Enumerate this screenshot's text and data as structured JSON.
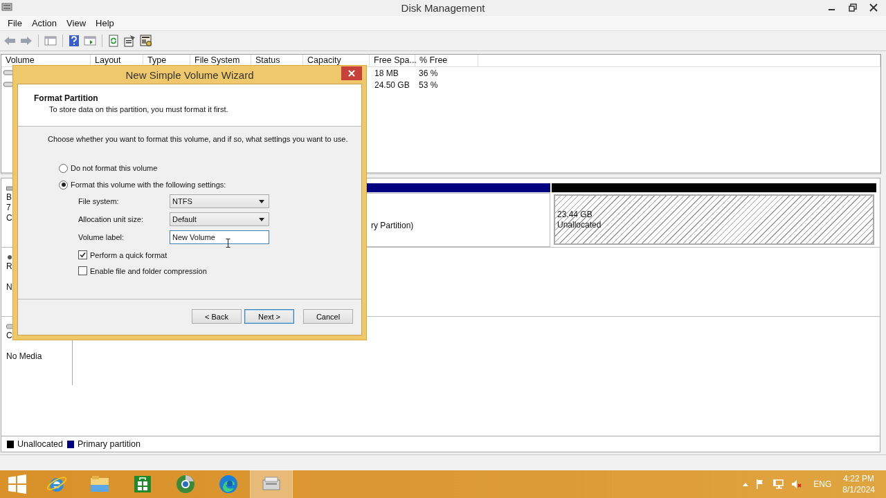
{
  "window": {
    "title": "Disk Management"
  },
  "menu": [
    "File",
    "Action",
    "View",
    "Help"
  ],
  "volume_list": {
    "columns": [
      "Volume",
      "Layout",
      "Type",
      "File System",
      "Status",
      "Capacity",
      "Free Spa...",
      "% Free"
    ],
    "rows": [
      {
        "free_space": "18 MB",
        "pct_free": "36 %"
      },
      {
        "free_space": "24.50 GB",
        "pct_free": "53 %"
      }
    ]
  },
  "disks": [
    {
      "kind": "disk",
      "label_lines": [
        "B",
        "7",
        "C"
      ],
      "partitions": [
        {
          "kind": "primary",
          "lines": [
            "ry Partition)"
          ]
        },
        {
          "kind": "unallocated",
          "lines": [
            "23.44 GB",
            "Unallocated"
          ]
        }
      ]
    },
    {
      "kind": "removable",
      "label_lines": [
        "R",
        "N"
      ]
    },
    {
      "kind": "cdrom",
      "label_lines": [
        "C",
        "No Media"
      ]
    }
  ],
  "legend": [
    {
      "label": "Unallocated",
      "color": "#000000"
    },
    {
      "label": "Primary partition",
      "color": "#000080"
    }
  ],
  "dialog": {
    "title": "New Simple Volume Wizard",
    "heading": "Format Partition",
    "subheading": "To store data on this partition, you must format it first.",
    "instruction": "Choose whether you want to format this volume, and if so, what settings you want to use.",
    "options": [
      {
        "label": "Do not format this volume",
        "selected": false
      },
      {
        "label": "Format this volume with the following settings:",
        "selected": true
      }
    ],
    "fields": [
      {
        "label": "File system:",
        "kind": "dropdown",
        "value": "NTFS"
      },
      {
        "label": "Allocation unit size:",
        "kind": "dropdown",
        "value": "Default"
      },
      {
        "label": "Volume label:",
        "kind": "text",
        "value": "New Volume"
      }
    ],
    "checkboxes": [
      {
        "label": "Perform a quick format",
        "checked": true
      },
      {
        "label": "Enable file and folder compression",
        "checked": false
      }
    ],
    "buttons": [
      {
        "label": "< Back",
        "default": false
      },
      {
        "label": "Next >",
        "default": true
      },
      {
        "label": "Cancel",
        "default": false
      }
    ]
  },
  "taskbar": {
    "apps": [
      {
        "kind": "ie",
        "selected": false
      },
      {
        "kind": "explorer",
        "selected": false
      },
      {
        "kind": "store",
        "selected": false
      },
      {
        "kind": "chrome",
        "selected": false
      },
      {
        "kind": "edge",
        "selected": false
      },
      {
        "kind": "diskmgmt",
        "selected": true
      }
    ],
    "language": "ENG",
    "time": "4:22 PM",
    "date": "8/1/2024"
  }
}
